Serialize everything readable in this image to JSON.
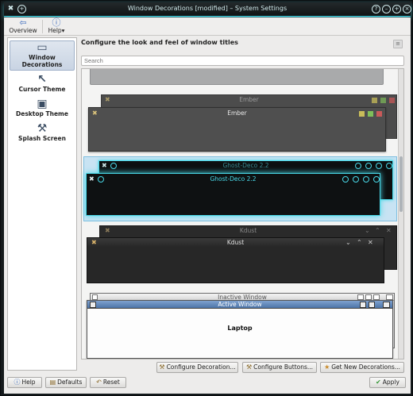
{
  "window": {
    "title": "Window Decorations [modified] – System Settings",
    "accent": "#49d9e8"
  },
  "toolbar": {
    "overview_label": "Overview",
    "help_label": "Help",
    "overview_icon": "back-arrow-icon",
    "help_icon": "help-icon"
  },
  "sidebar": {
    "items": [
      {
        "label": "Window Decorations",
        "icon": "window-icon",
        "selected": true
      },
      {
        "label": "Cursor Theme",
        "icon": "cursor-icon",
        "selected": false
      },
      {
        "label": "Desktop Theme",
        "icon": "desktop-icon",
        "selected": false
      },
      {
        "label": "Splash Screen",
        "icon": "tools-icon",
        "selected": false
      }
    ]
  },
  "main": {
    "heading": "Configure the look and feel of window titles",
    "search_placeholder": "Search"
  },
  "decorations": [
    {
      "name": "Ember",
      "inactive_title": "Ember",
      "active_title": "Ember",
      "selected": false
    },
    {
      "name": "Ghost-Deco 2.2",
      "inactive_title": "Ghost-Deco 2.2",
      "active_title": "Ghost-Deco 2.2",
      "selected": true
    },
    {
      "name": "Kdust",
      "inactive_title": "Kdust",
      "active_title": "Kdust",
      "selected": false
    },
    {
      "name": "Laptop",
      "inactive_title": "Inactive Window",
      "active_title": "Active Window",
      "body_label": "Laptop",
      "selected": false
    }
  ],
  "footer": {
    "configure_decoration": "Configure Decoration...",
    "configure_buttons": "Configure Buttons...",
    "get_new": "Get New Decorations...",
    "help": "Help",
    "defaults": "Defaults",
    "reset": "Reset",
    "apply": "Apply"
  }
}
